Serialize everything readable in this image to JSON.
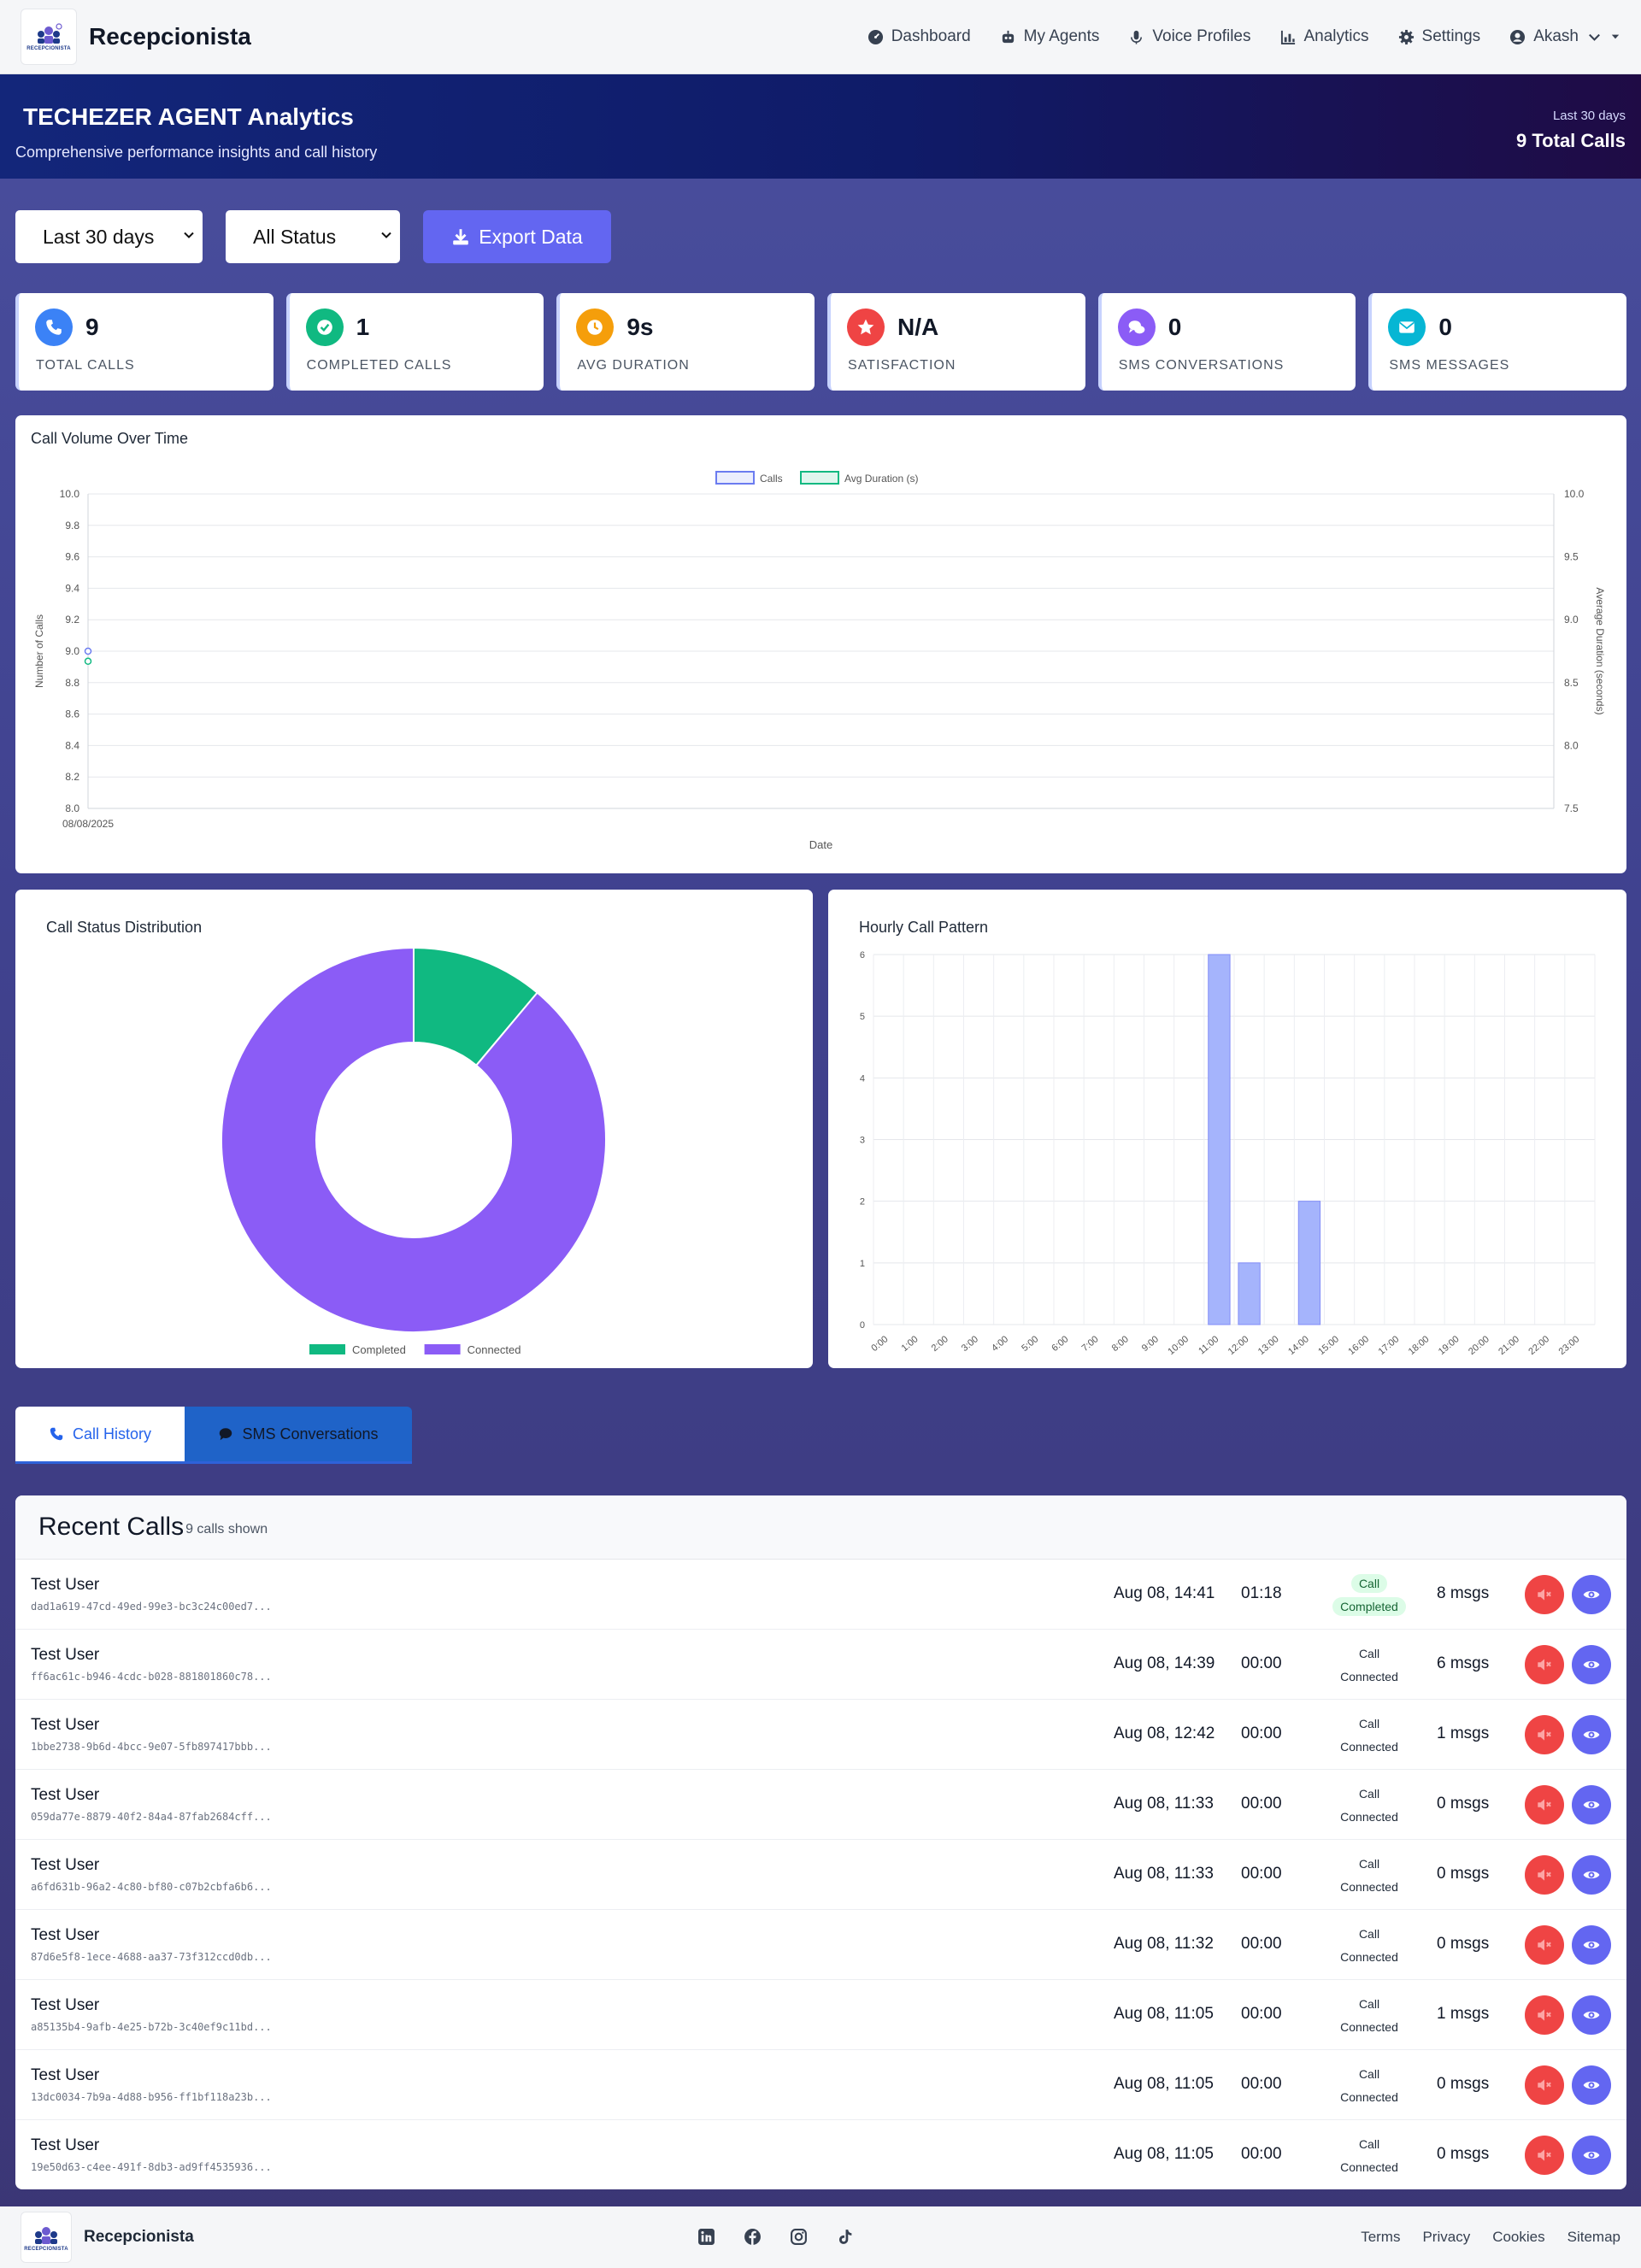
{
  "nav": {
    "brand": "Recepcionista",
    "logo_text": "RECEPCIONISTA",
    "links": [
      {
        "label": "Dashboard",
        "icon": "gauge-icon"
      },
      {
        "label": "My Agents",
        "icon": "robot-icon"
      },
      {
        "label": "Voice Profiles",
        "icon": "microphone-icon"
      },
      {
        "label": "Analytics",
        "icon": "bar-chart-icon"
      },
      {
        "label": "Settings",
        "icon": "gear-icon"
      },
      {
        "label": "Akash",
        "icon": "user-circle-icon"
      }
    ]
  },
  "hero": {
    "title": "TECHEZER AGENT Analytics",
    "subtitle": "Comprehensive performance insights and call history",
    "range": "Last 30 days",
    "total": "9 Total Calls"
  },
  "filters": {
    "period": "Last 30 days",
    "status": "All Status",
    "export_label": "Export Data"
  },
  "stats": [
    {
      "value": "9",
      "label": "TOTAL CALLS",
      "icon": "phone-icon",
      "color": "#3b82f6"
    },
    {
      "value": "1",
      "label": "COMPLETED CALLS",
      "icon": "check-circle-icon",
      "color": "#10b981"
    },
    {
      "value": "9s",
      "label": "AVG DURATION",
      "icon": "clock-icon",
      "color": "#f59e0b"
    },
    {
      "value": "N/A",
      "label": "SATISFACTION",
      "icon": "star-icon",
      "color": "#ef4444"
    },
    {
      "value": "0",
      "label": "SMS CONVERSATIONS",
      "icon": "chat-bubbles-icon",
      "color": "#8b5cf6"
    },
    {
      "value": "0",
      "label": "SMS MESSAGES",
      "icon": "envelope-icon",
      "color": "#06b6d4"
    }
  ],
  "chart_data": [
    {
      "type": "line",
      "title": "Call Volume Over Time",
      "xlabel": "Date",
      "ylabel": "Number of Calls",
      "y2label": "Average Duration (seconds)",
      "x": [
        "08/08/2025"
      ],
      "series": [
        {
          "name": "Calls",
          "values": [
            9
          ],
          "axis": "left",
          "color": "#6b7cf0"
        },
        {
          "name": "Avg Duration (s)",
          "values": [
            8.67
          ],
          "axis": "right",
          "color": "#10b981"
        }
      ],
      "ylim": [
        8.0,
        10.0
      ],
      "yticks": [
        "10.0",
        "9.8",
        "9.6",
        "9.4",
        "9.2",
        "9.0",
        "8.8",
        "8.6",
        "8.4",
        "8.2",
        "8.0"
      ],
      "y2lim": [
        7.5,
        10.0
      ],
      "y2ticks": [
        "10.0",
        "9.5",
        "9.0",
        "8.5",
        "8.0",
        "7.5"
      ],
      "legend": "top-center",
      "grid": true
    },
    {
      "type": "pie",
      "title": "Call Status Distribution",
      "categories": [
        "Completed",
        "Connected"
      ],
      "values": [
        1,
        8
      ],
      "colors": [
        "#10b981",
        "#8b5cf6"
      ],
      "legend": "bottom"
    },
    {
      "type": "bar",
      "title": "Hourly Call Pattern",
      "categories": [
        "0:00",
        "1:00",
        "2:00",
        "3:00",
        "4:00",
        "5:00",
        "6:00",
        "7:00",
        "8:00",
        "9:00",
        "10:00",
        "11:00",
        "12:00",
        "13:00",
        "14:00",
        "15:00",
        "16:00",
        "17:00",
        "18:00",
        "19:00",
        "20:00",
        "21:00",
        "22:00",
        "23:00"
      ],
      "values": [
        0,
        0,
        0,
        0,
        0,
        0,
        0,
        0,
        0,
        0,
        0,
        6,
        1,
        0,
        2,
        0,
        0,
        0,
        0,
        0,
        0,
        0,
        0,
        0
      ],
      "ylim": [
        0,
        6
      ],
      "yticks": [
        "6",
        "5",
        "4",
        "3",
        "2",
        "1",
        "0"
      ],
      "color": "#a5b4fc",
      "grid": true
    }
  ],
  "tabs": {
    "calls": "Call History",
    "sms": "SMS Conversations"
  },
  "calls": {
    "title": "Recent Calls",
    "count": "9 calls shown",
    "rows": [
      {
        "name": "Test User",
        "id": "dad1a619-47cd-49ed-99e3-bc3c24c00ed7...",
        "date": "Aug 08, 14:41",
        "duration": "01:18",
        "status_top": "Call",
        "status_bottom": "Completed",
        "msgs": "8 msgs"
      },
      {
        "name": "Test User",
        "id": "ff6ac61c-b946-4cdc-b028-881801860c78...",
        "date": "Aug 08, 14:39",
        "duration": "00:00",
        "status_top": "Call",
        "status_bottom": "Connected",
        "msgs": "6 msgs"
      },
      {
        "name": "Test User",
        "id": "1bbe2738-9b6d-4bcc-9e07-5fb897417bbb...",
        "date": "Aug 08, 12:42",
        "duration": "00:00",
        "status_top": "Call",
        "status_bottom": "Connected",
        "msgs": "1 msgs"
      },
      {
        "name": "Test User",
        "id": "059da77e-8879-40f2-84a4-87fab2684cff...",
        "date": "Aug 08, 11:33",
        "duration": "00:00",
        "status_top": "Call",
        "status_bottom": "Connected",
        "msgs": "0 msgs"
      },
      {
        "name": "Test User",
        "id": "a6fd631b-96a2-4c80-bf80-c07b2cbfa6b6...",
        "date": "Aug 08, 11:33",
        "duration": "00:00",
        "status_top": "Call",
        "status_bottom": "Connected",
        "msgs": "0 msgs"
      },
      {
        "name": "Test User",
        "id": "87d6e5f8-1ece-4688-aa37-73f312ccd0db...",
        "date": "Aug 08, 11:32",
        "duration": "00:00",
        "status_top": "Call",
        "status_bottom": "Connected",
        "msgs": "0 msgs"
      },
      {
        "name": "Test User",
        "id": "a85135b4-9afb-4e25-b72b-3c40ef9c11bd...",
        "date": "Aug 08, 11:05",
        "duration": "00:00",
        "status_top": "Call",
        "status_bottom": "Connected",
        "msgs": "1 msgs"
      },
      {
        "name": "Test User",
        "id": "13dc0034-7b9a-4d88-b956-ff1bf118a23b...",
        "date": "Aug 08, 11:05",
        "duration": "00:00",
        "status_top": "Call",
        "status_bottom": "Connected",
        "msgs": "0 msgs"
      },
      {
        "name": "Test User",
        "id": "19e50d63-c4ee-491f-8db3-ad9ff4535936...",
        "date": "Aug 08, 11:05",
        "duration": "00:00",
        "status_top": "Call",
        "status_bottom": "Connected",
        "msgs": "0 msgs"
      }
    ]
  },
  "footer": {
    "brand": "Recepcionista",
    "socials": [
      "linkedin-icon",
      "facebook-icon",
      "instagram-icon",
      "tiktok-icon"
    ],
    "links": [
      "Terms",
      "Privacy",
      "Cookies",
      "Sitemap"
    ]
  }
}
